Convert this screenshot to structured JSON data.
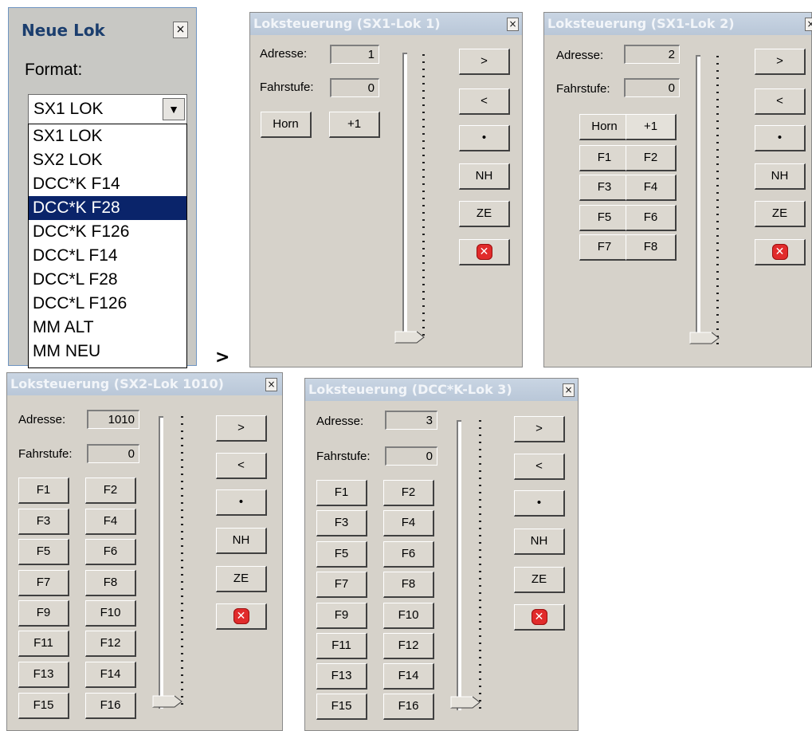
{
  "neue_lok": {
    "title": "Neue Lok",
    "close": "×",
    "format_label": "Format:",
    "selected": "SX1 LOK",
    "arrow": "▼",
    "options": [
      "SX1 LOK",
      "SX2 LOK",
      "DCC*K F14",
      "DCC*K F28",
      "DCC*K F126",
      "DCC*L F14",
      "DCC*L F28",
      "DCC*L F126",
      "MM ALT",
      "MM NEU"
    ],
    "highlighted": "DCC*K F28"
  },
  "arrow_text": ">",
  "common": {
    "adresse_label": "Adresse:",
    "fahrstufe_label": "Fahrstufe:",
    "close": "×",
    "btn_forward": ">",
    "btn_back": "<",
    "btn_dot": "•",
    "btn_nh": "NH",
    "btn_ze": "ZE",
    "btn_stop": "✕",
    "btn_horn": "Horn",
    "btn_plus1": "+1"
  },
  "windows": [
    {
      "title": "Loksteuerung (SX1-Lok 1)",
      "adresse": "1",
      "fahrstufe": "0"
    },
    {
      "title": "Loksteuerung (SX1-Lok 2)",
      "adresse": "2",
      "fahrstufe": "0",
      "functions": [
        "F1",
        "F2",
        "F3",
        "F4",
        "F5",
        "F6",
        "F7",
        "F8"
      ]
    },
    {
      "title": "Loksteuerung (SX2-Lok 1010)",
      "adresse": "1010",
      "fahrstufe": "0",
      "functions": [
        "F1",
        "F2",
        "F3",
        "F4",
        "F5",
        "F6",
        "F7",
        "F8",
        "F9",
        "F10",
        "F11",
        "F12",
        "F13",
        "F14",
        "F15",
        "F16"
      ]
    },
    {
      "title": "Loksteuerung (DCC*K-Lok 3)",
      "adresse": "3",
      "fahrstufe": "0",
      "functions": [
        "F1",
        "F2",
        "F3",
        "F4",
        "F5",
        "F6",
        "F7",
        "F8",
        "F9",
        "F10",
        "F11",
        "F12",
        "F13",
        "F14",
        "F15",
        "F16"
      ]
    }
  ]
}
